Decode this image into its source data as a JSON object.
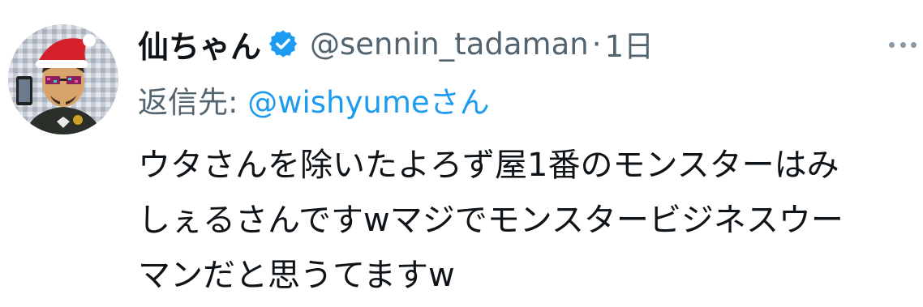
{
  "tweet": {
    "display_name": "仙ちゃん",
    "handle": "@sennin_tadaman",
    "separator": "·",
    "time": "1日",
    "reply_prefix": "返信先: ",
    "reply_handle": "@wishyume",
    "reply_suffix": "さん",
    "body_lines": [
      "ウタさんを除いたよろず屋1番のモンスターはみ",
      "しぇるさんですwマジでモンスタービジネスウー",
      "マンだと思うてますw"
    ]
  },
  "icons": {
    "verified": "verified-badge-icon",
    "more": "more-options-icon"
  },
  "colors": {
    "text": "#0f1419",
    "secondary": "#536471",
    "link": "#1d9bf0"
  }
}
